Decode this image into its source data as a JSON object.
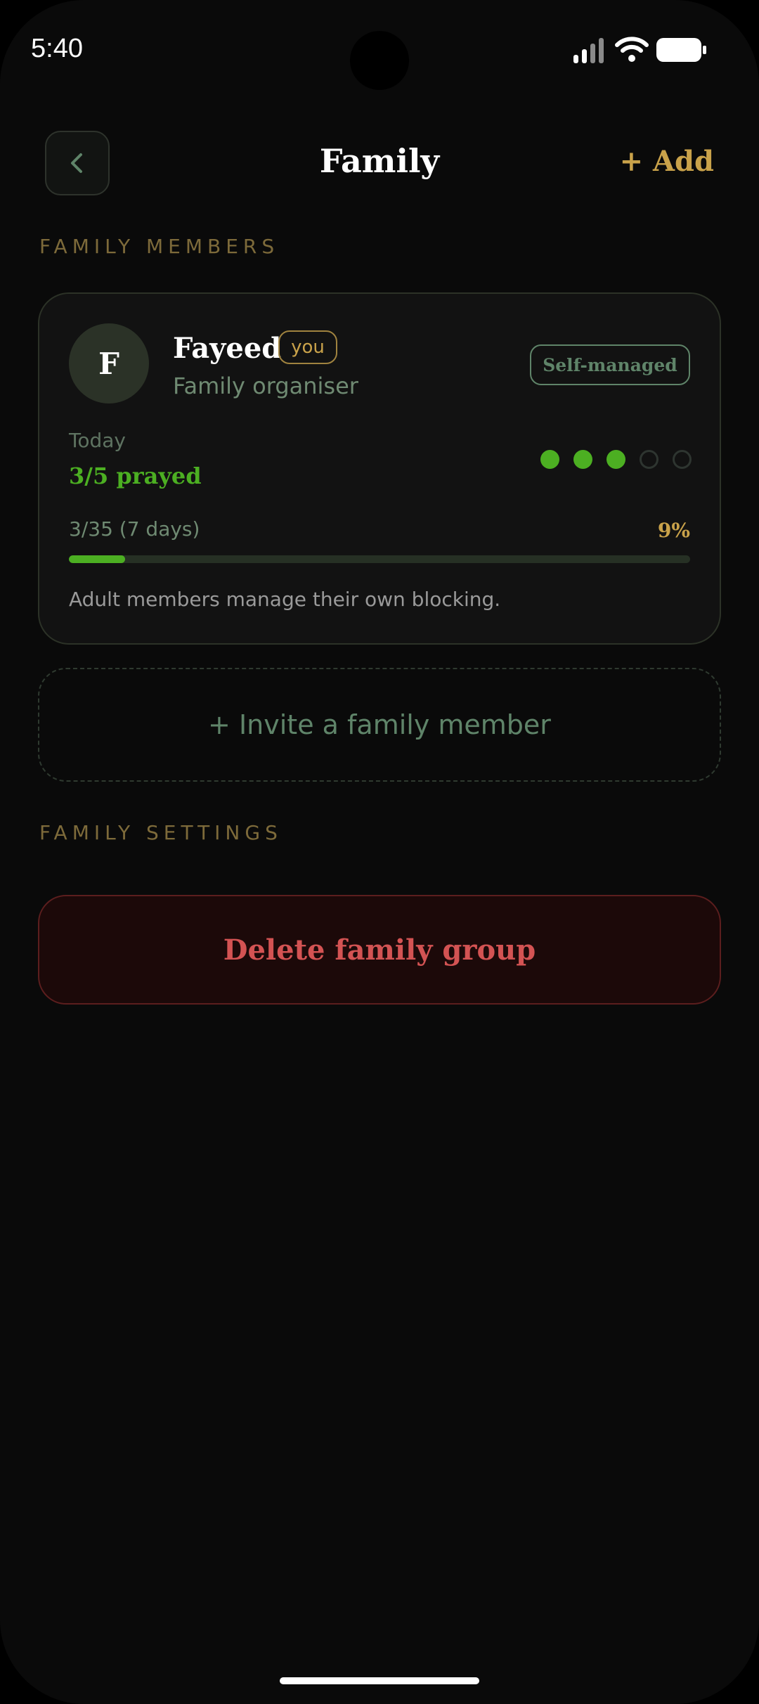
{
  "status_bar": {
    "time": "5:40",
    "icons": [
      "signal-icon",
      "wifi-icon",
      "battery-icon"
    ]
  },
  "header": {
    "title": "Family",
    "add_label": "+ Add",
    "back_icon": "chevron-left-icon"
  },
  "sections": {
    "members_label": "FAMILY MEMBERS",
    "settings_label": "FAMILY SETTINGS"
  },
  "member": {
    "initial": "F",
    "name": "Fayeed",
    "you_badge": "you",
    "role": "Family organiser",
    "managed_badge": "Self-managed",
    "today_label": "Today",
    "prayed": "3/5 prayed",
    "prayers_done": 3,
    "prayers_total": 5,
    "weekly": "3/35 (7 days)",
    "percent": "9%",
    "progress_fraction": 0.09,
    "note": "Adult members manage their own blocking."
  },
  "invite_label": "+ Invite a family member",
  "delete_label": "Delete family group",
  "colors": {
    "background": "#0a0a0a",
    "accent_gold": "#c9a24a",
    "accent_green": "#4caf22",
    "muted_green": "#5f8469",
    "danger_red": "#d35353"
  }
}
